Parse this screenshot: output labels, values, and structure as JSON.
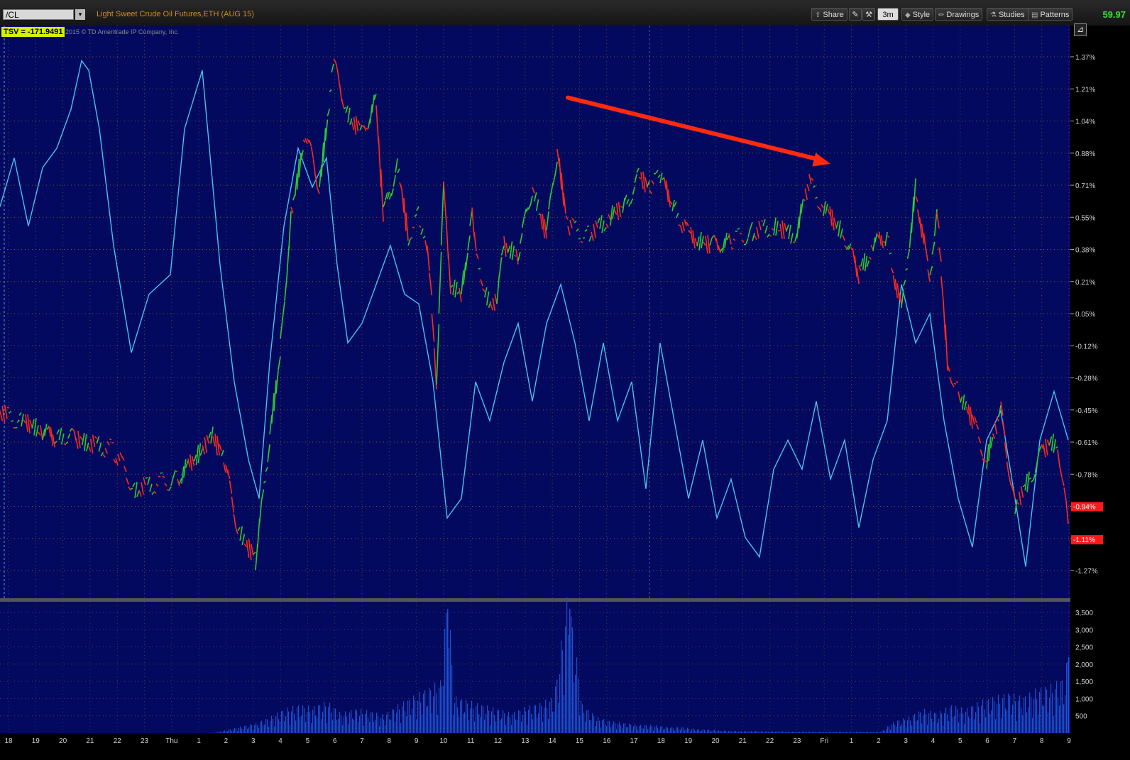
{
  "toolbar": {
    "symbol": "/CL",
    "title": "Light Sweet Crude Oil Futures,ETH (AUG 15)",
    "share_label": "Share",
    "timeframe_label": "3m",
    "style_label": "Style",
    "drawings_label": "Drawings",
    "studies_label": "Studies",
    "patterns_label": "Patterns",
    "last_price": "59.97",
    "icons": [
      "share-icon",
      "drawing-tool-icon",
      "wrench-icon",
      "style-icon",
      "pencil-icon",
      "studies-icon",
      "patterns-icon",
      "resize-icon"
    ]
  },
  "study": {
    "label": "TSV",
    "value_text": "TSV  = -171.9491",
    "copyright": "2015 © TD Ameritrade IP Company, Inc."
  },
  "colors": {
    "background": "#03095e",
    "up": "#2ecc2e",
    "down": "#ff2a1a",
    "study_line": "#46c3f0",
    "volume": "#1f4fd0",
    "grid": "#b87a2a",
    "arrow": "#ff2a10",
    "badge": "#ff1a1a"
  },
  "chart_data": {
    "type": "line",
    "title": "Light Sweet Crude Oil Futures,ETH (AUG 15)",
    "y_ticks": [
      "1.37%",
      "1.21%",
      "1.04%",
      "0.88%",
      "0.71%",
      "0.55%",
      "0.38%",
      "0.21%",
      "0.05%",
      "-0.12%",
      "-0.28%",
      "-0.45%",
      "-0.61%",
      "-0.78%",
      "-0.94%",
      "-1.11%",
      "-1.27%"
    ],
    "y_badges": [
      "-0.94%",
      "-1.11%"
    ],
    "volume_ticks": [
      "3,500",
      "3,000",
      "2,500",
      "2,000",
      "1,500",
      "1,000",
      "500"
    ],
    "x_ticks": [
      "18",
      "19",
      "20",
      "21",
      "22",
      "23",
      "Thu",
      "1",
      "2",
      "3",
      "4",
      "5",
      "6",
      "7",
      "8",
      "9",
      "10",
      "11",
      "12",
      "13",
      "14",
      "15",
      "16",
      "17",
      "18",
      "19",
      "20",
      "21",
      "22",
      "23",
      "Fri",
      "1",
      "2",
      "3",
      "4",
      "5",
      "6",
      "7",
      "8",
      "9"
    ],
    "price_series": {
      "name": "Price % change",
      "x": [
        0,
        10,
        30,
        60,
        80,
        90,
        110,
        160,
        190,
        250,
        300,
        315,
        335,
        360,
        380,
        395,
        410,
        430,
        450,
        470,
        490,
        510,
        530,
        540,
        560,
        575,
        590,
        605,
        615,
        625,
        635,
        650,
        665,
        680,
        700,
        710,
        730,
        750,
        770,
        785,
        800,
        830,
        860,
        880,
        900,
        915,
        930,
        950,
        970,
        1000,
        1030,
        1060,
        1090,
        1120,
        1140,
        1160,
        1190,
        1210,
        1230,
        1250,
        1270,
        1290,
        1310,
        1320,
        1335,
        1350,
        1370,
        1390,
        1410,
        1430,
        1450,
        1470,
        1490,
        1505
      ],
      "y": [
        -0.45,
        -0.48,
        -0.5,
        -0.55,
        -0.6,
        -0.57,
        -0.6,
        -0.65,
        -0.85,
        -0.8,
        -0.58,
        -0.7,
        -1.05,
        -1.22,
        -0.6,
        -0.12,
        0.55,
        0.98,
        0.7,
        1.33,
        1.08,
        0.97,
        1.15,
        0.55,
        0.82,
        0.45,
        0.55,
        0.3,
        -0.3,
        0.68,
        0.2,
        0.15,
        0.58,
        0.15,
        0.1,
        0.4,
        0.35,
        0.7,
        0.45,
        0.88,
        0.5,
        0.45,
        0.55,
        0.6,
        0.75,
        0.7,
        0.75,
        0.6,
        0.45,
        0.4,
        0.42,
        0.47,
        0.5,
        0.45,
        0.72,
        0.6,
        0.45,
        0.25,
        0.4,
        0.45,
        0.05,
        0.7,
        0.2,
        0.6,
        -0.2,
        -0.35,
        -0.5,
        -0.7,
        -0.45,
        -0.95,
        -0.8,
        -0.65,
        -0.6,
        -1.05
      ],
      "color": "#ff2a1a"
    },
    "study_series": {
      "name": "TSV",
      "x": [
        0,
        20,
        40,
        60,
        80,
        100,
        115,
        125,
        140,
        160,
        185,
        210,
        240,
        260,
        285,
        310,
        330,
        350,
        365,
        380,
        400,
        420,
        440,
        460,
        475,
        490,
        510,
        530,
        550,
        570,
        590,
        610,
        630,
        650,
        670,
        690,
        710,
        730,
        750,
        770,
        790,
        810,
        830,
        850,
        870,
        890,
        910,
        930,
        950,
        970,
        990,
        1010,
        1030,
        1050,
        1070,
        1090,
        1110,
        1130,
        1150,
        1170,
        1190,
        1210,
        1230,
        1250,
        1270,
        1290,
        1310,
        1330,
        1350,
        1370,
        1390,
        1410,
        1430,
        1445,
        1465,
        1485,
        1505
      ],
      "y": [
        0.6,
        0.85,
        0.5,
        0.8,
        0.9,
        1.1,
        1.35,
        1.3,
        1.0,
        0.4,
        -0.15,
        0.15,
        0.25,
        1.0,
        1.3,
        0.3,
        -0.3,
        -0.7,
        -0.9,
        -0.2,
        0.5,
        0.9,
        0.7,
        0.85,
        0.3,
        -0.1,
        0.0,
        0.2,
        0.4,
        0.15,
        0.1,
        -0.3,
        -1.0,
        -0.9,
        -0.3,
        -0.5,
        -0.2,
        0.0,
        -0.4,
        0.0,
        0.2,
        -0.1,
        -0.5,
        -0.1,
        -0.5,
        -0.3,
        -0.85,
        -0.1,
        -0.5,
        -0.9,
        -0.6,
        -1.0,
        -0.8,
        -1.1,
        -1.2,
        -0.75,
        -0.6,
        -0.75,
        -0.4,
        -0.8,
        -0.6,
        -1.05,
        -0.7,
        -0.5,
        0.2,
        -0.1,
        0.05,
        -0.5,
        -0.9,
        -1.15,
        -0.6,
        -0.45,
        -0.9,
        -1.25,
        -0.6,
        -0.35,
        -0.6
      ],
      "color": "#46c3f0"
    },
    "volume": {
      "x": [
        0,
        100,
        200,
        300,
        360,
        380,
        400,
        420,
        440,
        460,
        480,
        500,
        520,
        540,
        560,
        580,
        600,
        620,
        630,
        640,
        660,
        680,
        700,
        720,
        740,
        760,
        780,
        800,
        820,
        840,
        860,
        880,
        900,
        920,
        940,
        960,
        980,
        1000,
        1020,
        1040,
        1060,
        1080,
        1100,
        1120,
        1140,
        1160,
        1180,
        1200,
        1220,
        1240,
        1260,
        1280,
        1300,
        1320,
        1340,
        1360,
        1380,
        1400,
        1420,
        1440,
        1460,
        1480,
        1500,
        1505
      ],
      "y": [
        0,
        0,
        0,
        0,
        250,
        400,
        600,
        700,
        650,
        800,
        500,
        600,
        550,
        450,
        700,
        900,
        1100,
        1300,
        3600,
        900,
        800,
        700,
        600,
        500,
        650,
        750,
        900,
        3600,
        700,
        400,
        300,
        250,
        200,
        200,
        150,
        150,
        100,
        80,
        60,
        50,
        50,
        40,
        40,
        30,
        30,
        30,
        30,
        30,
        30,
        30,
        300,
        400,
        600,
        500,
        700,
        600,
        800,
        900,
        1000,
        900,
        1100,
        1200,
        1400,
        2200
      ]
    },
    "annotation": {
      "type": "arrow",
      "from": {
        "x": 800,
        "y": 1.16
      },
      "to": {
        "x": 1170,
        "y": 0.82
      }
    }
  }
}
